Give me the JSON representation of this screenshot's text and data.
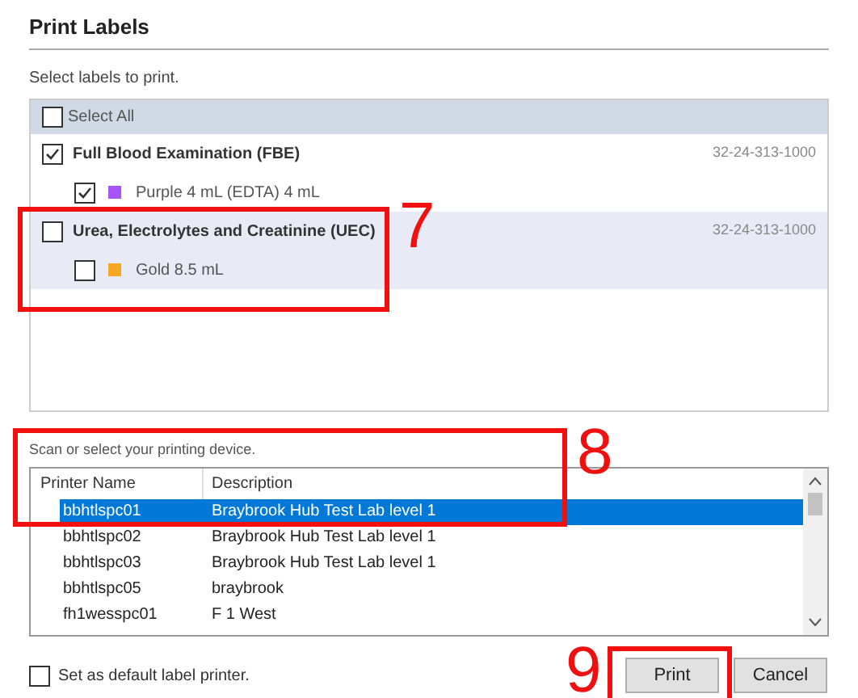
{
  "title": "Print Labels",
  "labels_prompt": "Select labels to print.",
  "select_all": {
    "label": "Select All",
    "checked": false
  },
  "tests": [
    {
      "name": "Full Blood Examination (FBE)",
      "code": "32-24-313-1000",
      "checked": true,
      "highlighted": false,
      "tubes": [
        {
          "label": "Purple 4 mL (EDTA) 4 mL",
          "checked": true,
          "color": "#a855f7"
        }
      ]
    },
    {
      "name": "Urea, Electrolytes and Creatinine (UEC)",
      "code": "32-24-313-1000",
      "checked": false,
      "highlighted": true,
      "tubes": [
        {
          "label": "Gold 8.5 mL",
          "checked": false,
          "color": "#f5a623"
        }
      ]
    }
  ],
  "printer_prompt": "Scan or select your printing device.",
  "printers": {
    "columns": [
      "Printer Name",
      "Description"
    ],
    "rows": [
      {
        "name": "bbhtlspc01",
        "description": "Braybrook Hub Test Lab level 1",
        "selected": true
      },
      {
        "name": "bbhtlspc02",
        "description": "Braybrook Hub Test Lab level 1",
        "selected": false
      },
      {
        "name": "bbhtlspc03",
        "description": "Braybrook Hub Test Lab level 1",
        "selected": false
      },
      {
        "name": "bbhtlspc05",
        "description": "braybrook",
        "selected": false
      },
      {
        "name": "fh1wesspc01",
        "description": "F 1 West",
        "selected": false
      }
    ]
  },
  "default_printer": {
    "label": "Set as default label printer.",
    "checked": false
  },
  "buttons": [
    "Print",
    "Cancel"
  ],
  "annotations": [
    "7",
    "8",
    "9"
  ]
}
